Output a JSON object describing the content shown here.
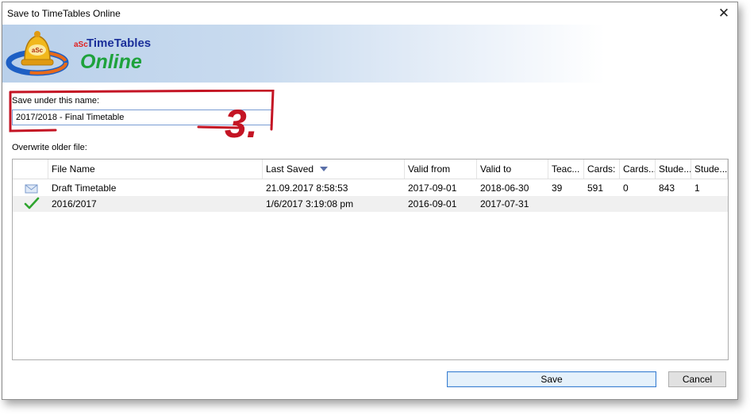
{
  "window": {
    "title": "Save to TimeTables Online",
    "close_glyph": "✕"
  },
  "banner": {
    "brand_prefix": "aSc",
    "brand_name": "TimeTables",
    "brand_online": "Online",
    "logo_text": "aSc"
  },
  "form": {
    "name_label": "Save under this name:",
    "name_value": "2017/2018 - Final Timetable",
    "step_number": "3.",
    "overwrite_label": "Overwrite older file:"
  },
  "table": {
    "columns": [
      "",
      "File Name",
      "Last Saved",
      "Valid from",
      "Valid to",
      "Teac...",
      "Cards:",
      "Cards...",
      "Stude...",
      "Stude..."
    ],
    "sort_column": "Last Saved",
    "sort_direction": "descending",
    "rows": [
      {
        "icon": "envelope-icon",
        "file_name": "Draft Timetable",
        "last_saved": "21.09.2017 8:58:53",
        "valid_from": "2017-09-01",
        "valid_to": "2018-06-30",
        "teachers": "39",
        "cards": "591",
        "cards2": "0",
        "students": "843",
        "students2": "1"
      },
      {
        "icon": "checkmark-icon",
        "file_name": "2016/2017",
        "last_saved": "1/6/2017 3:19:08 pm",
        "valid_from": "2016-09-01",
        "valid_to": "2017-07-31",
        "teachers": "",
        "cards": "",
        "cards2": "",
        "students": "",
        "students2": ""
      }
    ]
  },
  "buttons": {
    "save": "Save",
    "cancel": "Cancel"
  },
  "colors": {
    "accent": "#c41424",
    "brand_blue": "#1b2f9a",
    "brand_green": "#1ea23c",
    "focus_border": "#3c7fd1"
  }
}
